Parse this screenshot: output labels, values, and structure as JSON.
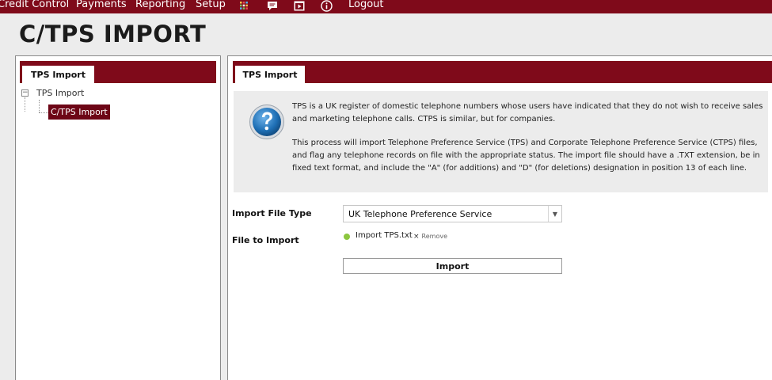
{
  "nav": {
    "items": [
      "Credit Control",
      "Payments",
      "Reporting",
      "Setup"
    ],
    "icons": [
      "grid-icon",
      "chat-icon",
      "media-icon",
      "info-icon"
    ],
    "logout": "Logout"
  },
  "page": {
    "title": "C/TPS IMPORT"
  },
  "left_panel": {
    "tab": "TPS Import",
    "tree": {
      "root_toggle": "−",
      "root": "TPS Import",
      "child": "C/TPS Import"
    }
  },
  "right_panel": {
    "tab": "TPS Import",
    "info": {
      "paragraph1": "TPS is a UK register of domestic telephone numbers whose users have indicated that they do not wish to receive sales and marketing telephone calls. CTPS is similar, but for companies.",
      "paragraph2": "This process will import Telephone Preference Service (TPS) and Corporate Telephone Preference Service (CTPS) files, and flag any telephone records on file with the appropriate status. The import file should have a .TXT extension, be in fixed text format, and include the \"A\" (for additions) and \"D\" (for deletions) designation in position 13 of each line."
    },
    "form": {
      "file_type_label": "Import File Type",
      "file_type_value": "UK Telephone Preference Service",
      "file_label": "File to Import",
      "file_name": "Import TPS.txt",
      "remove_x": "×",
      "remove_label": "Remove",
      "import_button": "Import"
    }
  },
  "colors": {
    "brand": "#7f0a1a",
    "tree_selected": "#6d0616",
    "file_status": "#8cc63f",
    "help_icon": "#1e6fb5"
  }
}
